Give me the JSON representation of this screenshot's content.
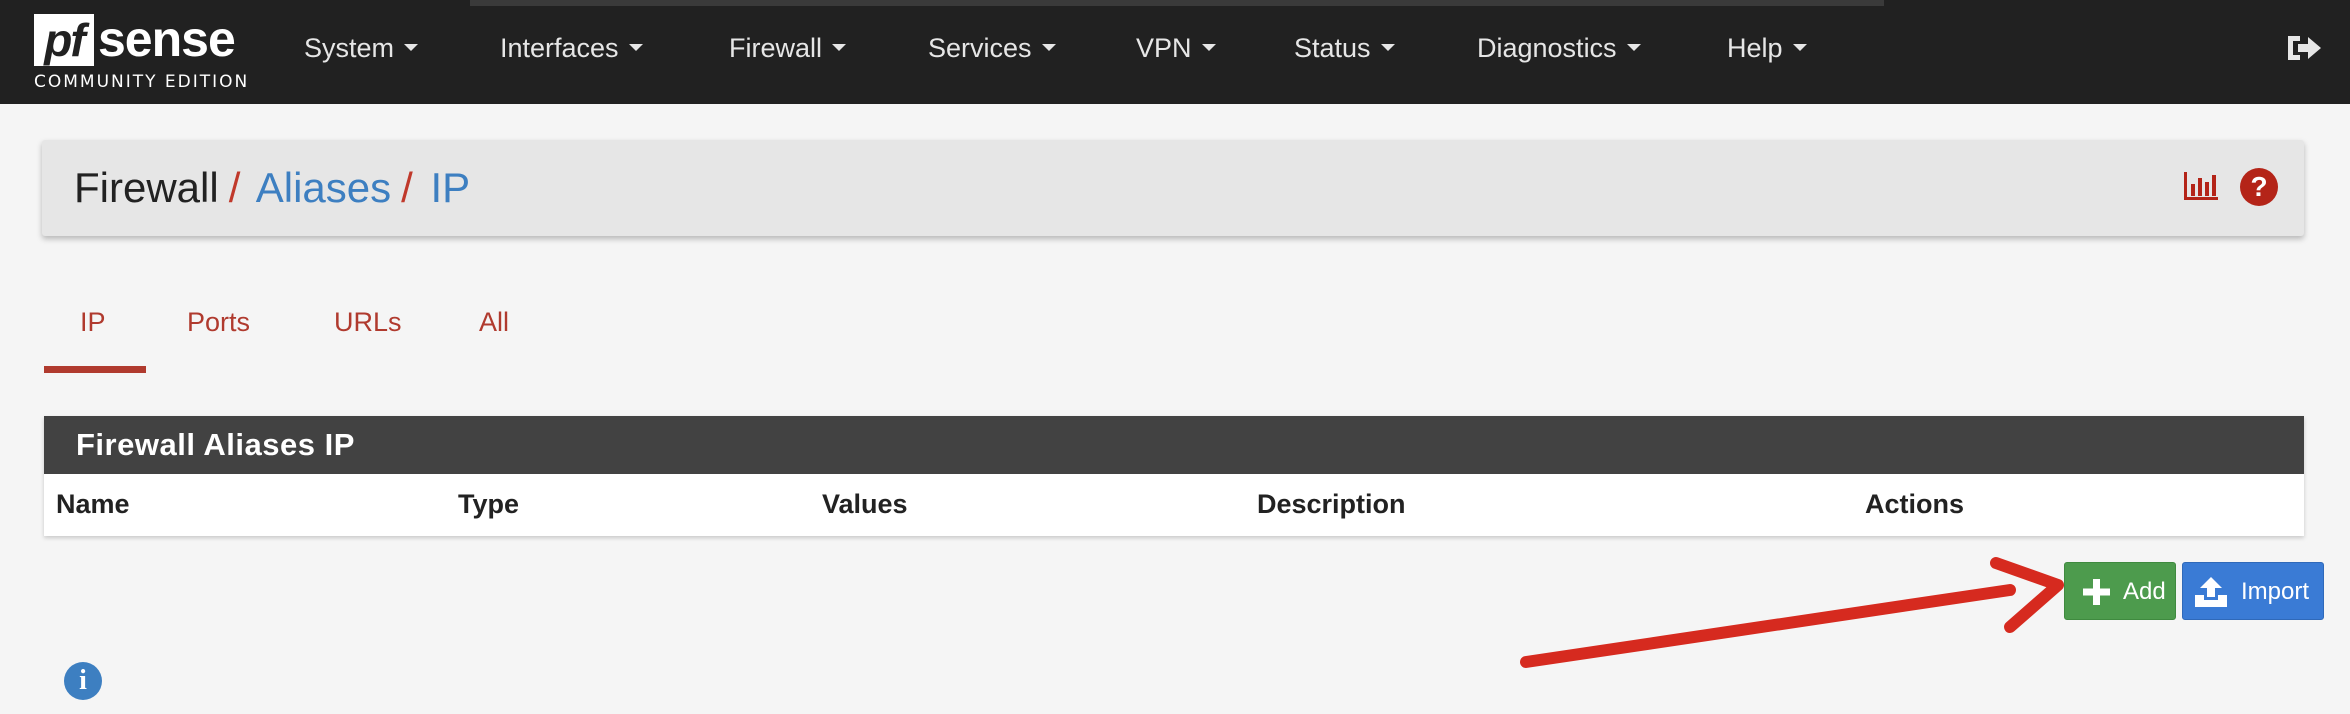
{
  "logo": {
    "pf": "pf",
    "sense": "sense",
    "edition": "COMMUNITY EDITION"
  },
  "nav": {
    "items": [
      {
        "label": "System"
      },
      {
        "label": "Interfaces"
      },
      {
        "label": "Firewall"
      },
      {
        "label": "Services"
      },
      {
        "label": "VPN"
      },
      {
        "label": "Status"
      },
      {
        "label": "Diagnostics"
      },
      {
        "label": "Help"
      }
    ],
    "logout_icon": "sign-out-icon"
  },
  "breadcrumb": {
    "root": "Firewall",
    "sep": "/",
    "level2": "Aliases",
    "level3": "IP"
  },
  "header_icons": {
    "chart": "bar-chart-icon",
    "help": "?"
  },
  "tabs": [
    {
      "label": "IP"
    },
    {
      "label": "Ports"
    },
    {
      "label": "URLs"
    },
    {
      "label": "All"
    }
  ],
  "active_tab": "IP",
  "table": {
    "title": "Firewall Aliases IP",
    "columns": [
      "Name",
      "Type",
      "Values",
      "Description",
      "Actions"
    ],
    "rows": []
  },
  "buttons": {
    "add": "Add",
    "import": "Import"
  },
  "info_icon": "i",
  "colors": {
    "navbar": "#212121",
    "accent_red": "#b03a2e",
    "link_blue": "#3d7fc1",
    "add_green": "#4d9b4d",
    "import_blue": "#3a7bd5",
    "annotation_arrow": "#d62a1f"
  }
}
